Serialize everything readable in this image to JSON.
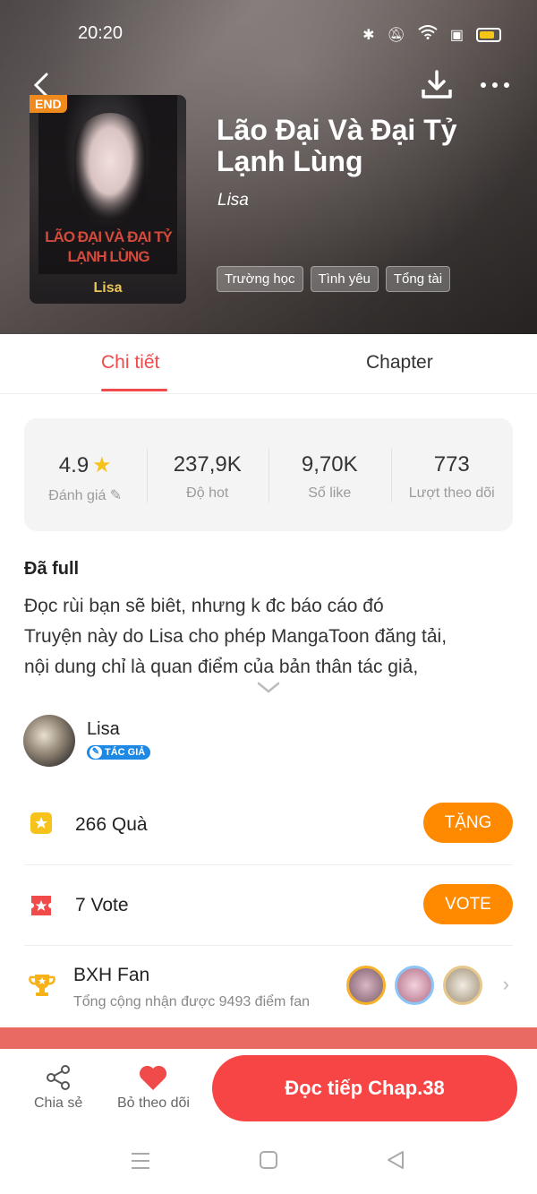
{
  "status_bar": {
    "time": "20:20"
  },
  "book": {
    "end_tag": "END",
    "title": "Lão Đại Và Đại Tỷ Lạnh Lùng",
    "author": "Lisa",
    "cover_title": "LÃO ĐẠI VÀ ĐẠI TỶ LẠNH LÙNG",
    "cover_author": "Lisa",
    "tags": [
      "Trường học",
      "Tình yêu",
      "Tổng tài"
    ]
  },
  "tabs": [
    {
      "label": "Chi tiết",
      "active": true
    },
    {
      "label": "Chapter",
      "active": false
    }
  ],
  "stats": [
    {
      "value": "4.9",
      "label": "Đánh giá"
    },
    {
      "value": "237,9K",
      "label": "Độ hot"
    },
    {
      "value": "9,70K",
      "label": "Số like"
    },
    {
      "value": "773",
      "label": "Lượt theo dõi"
    }
  ],
  "description": {
    "status": "Đã full",
    "lines": [
      "Đọc rùi bạn sẽ biêt, nhưng k đc báo cáo đó",
      "Truyện này do Lisa cho phép MangaToon đăng tải,",
      "nội dung chỉ là quan điểm của bản thân tác giả,"
    ]
  },
  "author_row": {
    "name": "Lisa",
    "badge": "TÁC GIẢ"
  },
  "gifts": {
    "label": "266  Quà",
    "button": "TẶNG"
  },
  "votes": {
    "label": "7  Vote",
    "button": "VOTE"
  },
  "fan_rank": {
    "title": "BXH Fan",
    "subtitle": "Tổng cộng nhận được 9493 điểm fan"
  },
  "bottom_bar": {
    "share_label": "Chia sẻ",
    "unfollow_label": "Bỏ theo dõi",
    "read_button": "Đọc tiếp Chap.38"
  },
  "colors": {
    "accent": "#f04a4a",
    "button_orange": "#ff8a00",
    "read_button": "#f74545",
    "star": "#f7c21a"
  }
}
